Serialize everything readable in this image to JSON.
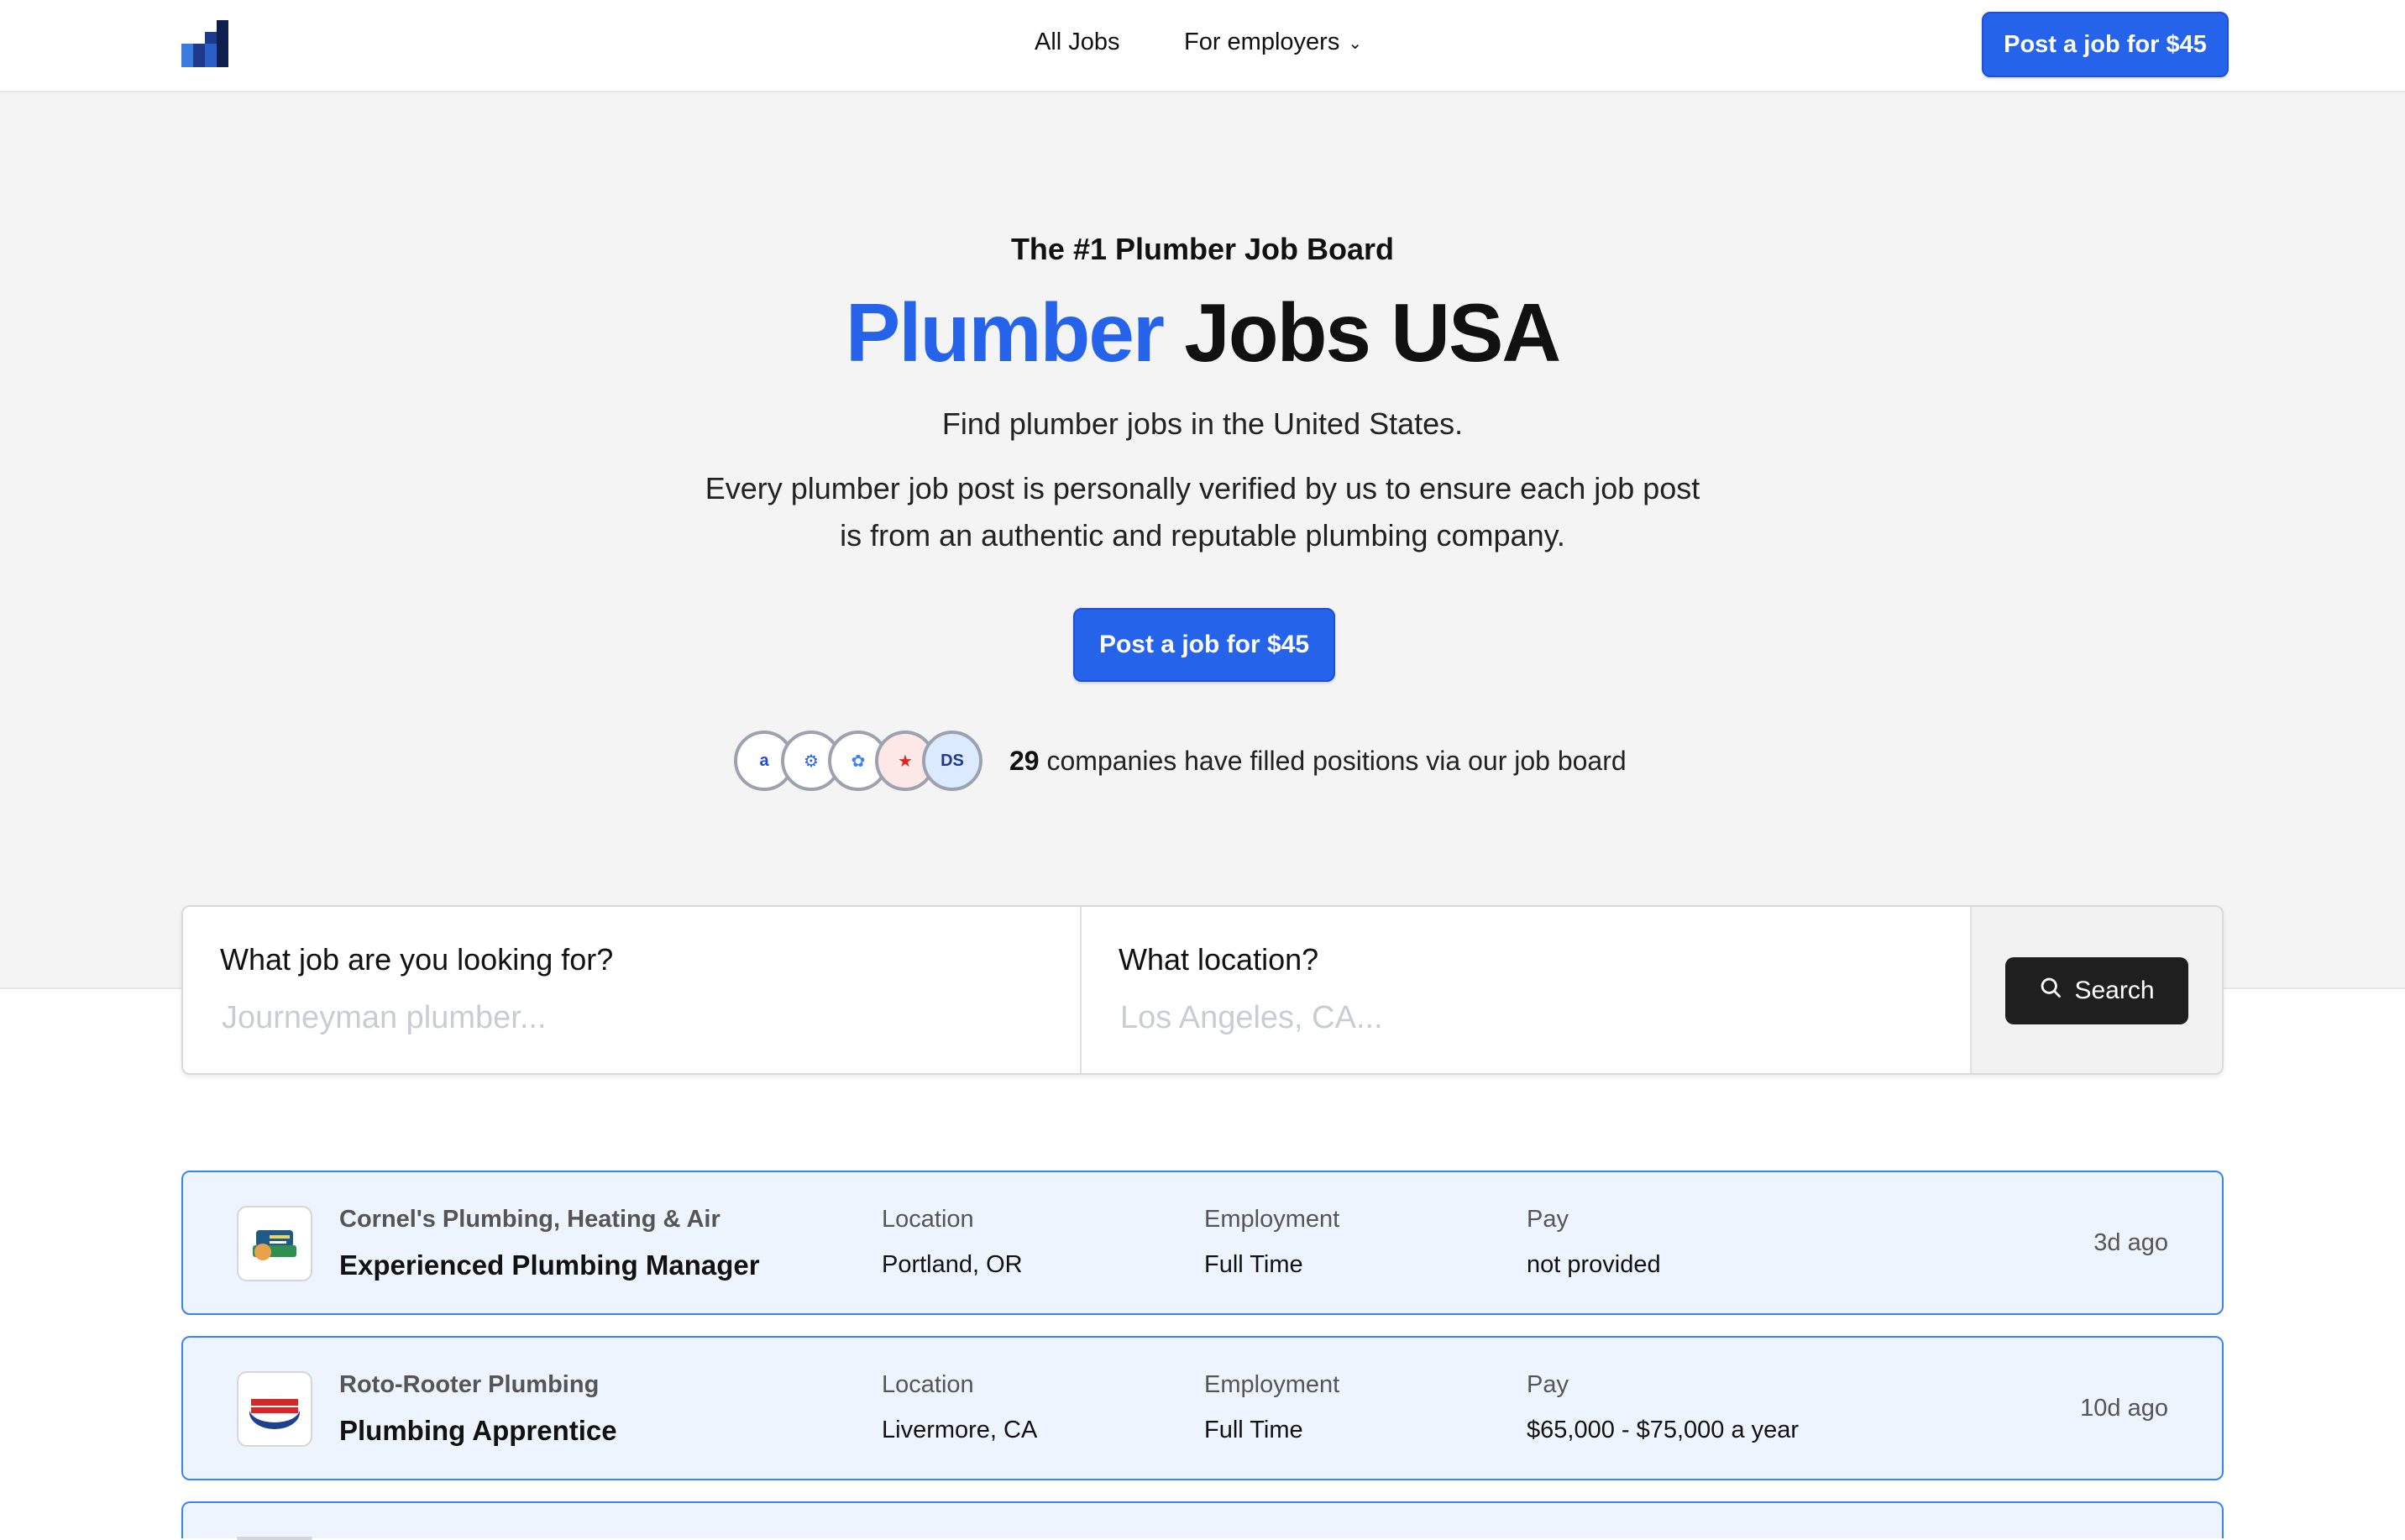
{
  "header": {
    "nav": {
      "all_jobs": "All Jobs",
      "for_employers": "For employers"
    },
    "cta": "Post a job for $45"
  },
  "hero": {
    "tagline": "The #1 Plumber Job Board",
    "title_accent": "Plumber",
    "title_rest": "Jobs USA",
    "subtitle": "Find plumber jobs in the United States.",
    "description": "Every plumber job post is personally verified by us to ensure each job post is from an authentic and reputable plumbing company.",
    "cta": "Post a job for $45",
    "proof_count": "29",
    "proof_text": "companies have filled positions via our job board"
  },
  "search": {
    "job_label": "What job are you looking for?",
    "job_placeholder": "Journeyman plumber...",
    "job_value": "",
    "location_label": "What location?",
    "location_placeholder": "Los Angeles, CA...",
    "location_value": "",
    "button": "Search"
  },
  "jobs": [
    {
      "company": "Cornel's Plumbing, Heating & Air",
      "title": "Experienced Plumbing Manager",
      "location_label": "Location",
      "location": "Portland, OR",
      "employment_label": "Employment",
      "employment": "Full Time",
      "pay_label": "Pay",
      "pay": "not provided",
      "age": "3d ago"
    },
    {
      "company": "Roto-Rooter Plumbing",
      "title": "Plumbing Apprentice",
      "location_label": "Location",
      "location": "Livermore, CA",
      "employment_label": "Employment",
      "employment": "Full Time",
      "pay_label": "Pay",
      "pay": "$65,000 - $75,000 a year",
      "age": "10d ago"
    }
  ],
  "colors": {
    "accent": "#2563eb",
    "card_bg": "#eef4fd",
    "card_border": "#3b82f6"
  }
}
